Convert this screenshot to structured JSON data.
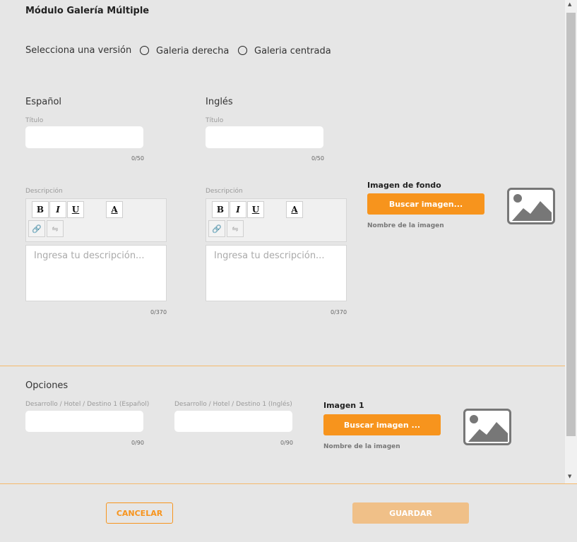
{
  "page_title": "Módulo Galería Múltiple",
  "version": {
    "label": "Selecciona una versión",
    "options": [
      "Galeria derecha",
      "Galeria centrada"
    ]
  },
  "spanish": {
    "heading": "Español",
    "title_label": "Título",
    "title_counter": "0/50",
    "desc_label": "Descripción",
    "desc_placeholder": "Ingresa tu descripción...",
    "desc_counter": "0/370"
  },
  "english": {
    "heading": "Inglés",
    "title_label": "Título",
    "title_counter": "0/50",
    "desc_label": "Descripción",
    "desc_placeholder": "Ingresa tu descripción...",
    "desc_counter": "0/370"
  },
  "toolbar": {
    "bold": "B",
    "italic": "I",
    "underline": "U",
    "color": "A"
  },
  "background_image": {
    "label": "Imagen de fondo",
    "button": "Buscar imagen...",
    "filename_label": "Nombre de la imagen"
  },
  "options": {
    "heading": "Opciones",
    "field_es_label": "Desarrollo / Hotel / Destino 1 (Español)",
    "field_es_counter": "0/90",
    "field_en_label": "Desarrollo / Hotel / Destino 1 (Inglés)",
    "field_en_counter": "0/90",
    "image_label": "Imagen 1",
    "image_button": "Buscar imagen ...",
    "image_filename_label": "Nombre de la imagen"
  },
  "footer": {
    "cancel": "CANCELAR",
    "save": "GUARDAR"
  },
  "colors": {
    "accent": "#f7941d",
    "save_disabled": "#f0c088",
    "background": "#e6e6e6"
  }
}
